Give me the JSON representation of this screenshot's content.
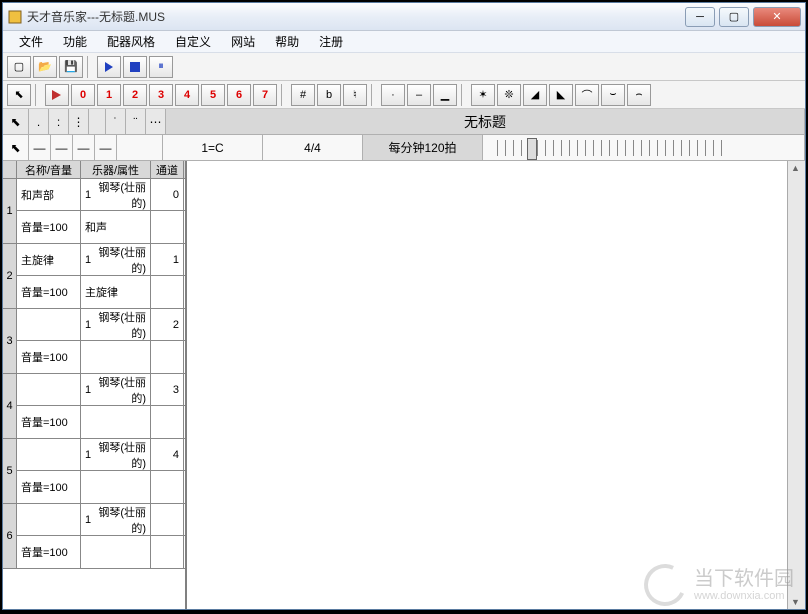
{
  "window": {
    "title": "天才音乐家---无标题.MUS"
  },
  "menu": {
    "file": "文件",
    "function": "功能",
    "arrange_style": "配器风格",
    "custom": "自定义",
    "website": "网站",
    "help": "帮助",
    "register": "注册"
  },
  "toolbar2": {
    "n0": "0",
    "n1": "1",
    "n2": "2",
    "n3": "3",
    "n4": "4",
    "n5": "5",
    "n6": "6",
    "n7": "7",
    "sharp": "#",
    "flat": "b",
    "natural": "♮"
  },
  "docbar": {
    "doc_title": "无标题"
  },
  "infobar": {
    "key": "1=C",
    "timesig": "4/4",
    "tempo": "每分钟120拍"
  },
  "side_headers": {
    "name_vol": "名称/音量",
    "instr_attr": "乐器/属性",
    "channel": "通道"
  },
  "tracks": [
    {
      "num": "1",
      "name": "和声部",
      "instr_ix": "1",
      "instr": "钢琴(壮丽的)",
      "channel": "0",
      "vol": "音量=100",
      "attr": "和声"
    },
    {
      "num": "2",
      "name": "主旋律",
      "instr_ix": "1",
      "instr": "钢琴(壮丽的)",
      "channel": "1",
      "vol": "音量=100",
      "attr": "主旋律"
    },
    {
      "num": "3",
      "name": "",
      "instr_ix": "1",
      "instr": "钢琴(壮丽的)",
      "channel": "2",
      "vol": "音量=100",
      "attr": ""
    },
    {
      "num": "4",
      "name": "",
      "instr_ix": "1",
      "instr": "钢琴(壮丽的)",
      "channel": "3",
      "vol": "音量=100",
      "attr": ""
    },
    {
      "num": "5",
      "name": "",
      "instr_ix": "1",
      "instr": "钢琴(壮丽的)",
      "channel": "4",
      "vol": "音量=100",
      "attr": ""
    },
    {
      "num": "6",
      "name": "",
      "instr_ix": "1",
      "instr": "钢琴(壮丽的)",
      "channel": "",
      "vol": "音量=100",
      "attr": ""
    }
  ],
  "watermark": {
    "cn": "当下软件园",
    "url": "www.downxia.com"
  }
}
